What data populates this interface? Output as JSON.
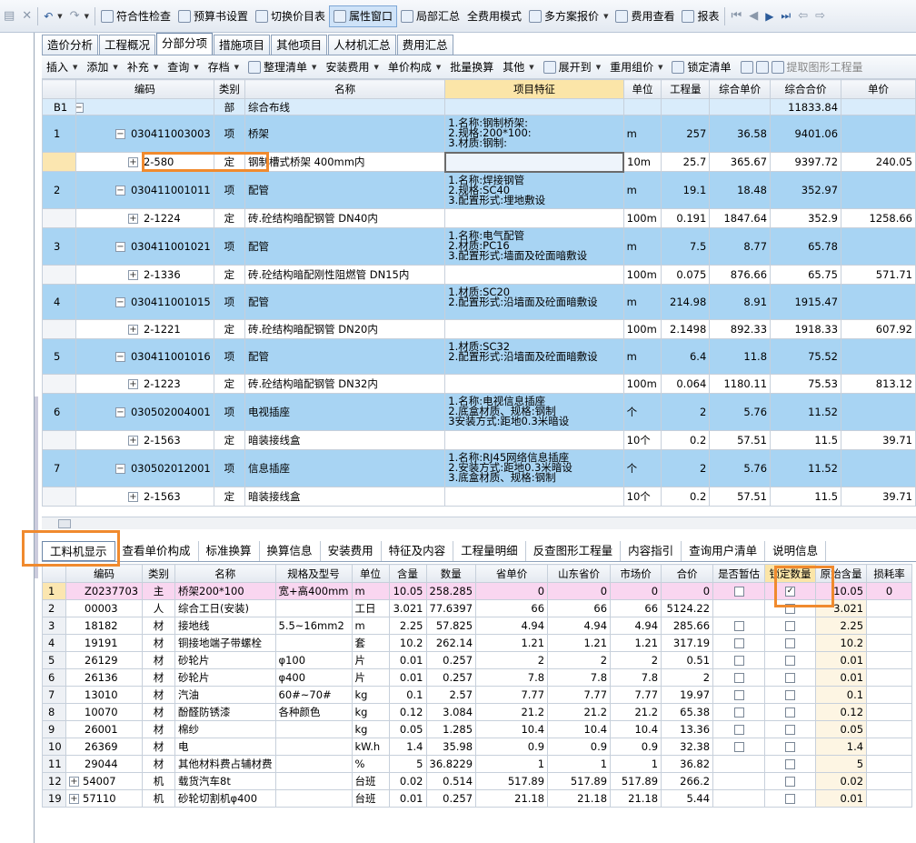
{
  "toolbar": {
    "items": [
      {
        "label": "符合性检查",
        "icon": "check-icon"
      },
      {
        "label": "预算书设置",
        "icon": "gear-icon"
      },
      {
        "label": "切换价目表",
        "icon": "switch-icon"
      },
      {
        "label": "属性窗口",
        "icon": "window-icon"
      },
      {
        "label": "局部汇总",
        "icon": "summary-icon"
      },
      {
        "label": "全费用模式",
        "icon": ""
      },
      {
        "label": "多方案报价",
        "icon": "scheme-icon"
      },
      {
        "label": "费用查看",
        "icon": "view-icon"
      },
      {
        "label": "报表",
        "icon": "report-icon"
      }
    ]
  },
  "tabs": [
    "造价分析",
    "工程概况",
    "分部分项",
    "措施项目",
    "其他项目",
    "人材机汇总",
    "费用汇总"
  ],
  "active_tab": "分部分项",
  "toolbar2": [
    "插入",
    "添加",
    "补充",
    "查询",
    "存档",
    "整理清单",
    "安装费用",
    "单价构成",
    "批量换算",
    "其他",
    "展开到",
    "重用组价",
    "锁定清单",
    "提取图形工程量"
  ],
  "grid1": {
    "headers": [
      "编码",
      "类别",
      "名称",
      "项目特征",
      "单位",
      "工程量",
      "综合单价",
      "综合合价",
      "单价"
    ],
    "rows": [
      {
        "rn": "B1",
        "type": "bu",
        "code": "",
        "cat": "部",
        "name": "综合布线",
        "feat": "",
        "unit": "",
        "qty": "",
        "uprice": "",
        "total": "11833.84",
        "price": ""
      },
      {
        "rn": "1",
        "type": "item",
        "code": "030411003003",
        "cat": "项",
        "name": "桥架",
        "feat": "1.名称:钢制桥架:\n2.规格:200*100:\n3.材质:钢制:",
        "unit": "m",
        "qty": "257",
        "uprice": "36.58",
        "total": "9401.06",
        "price": ""
      },
      {
        "rn": "",
        "type": "sel",
        "code": "2-580",
        "cat": "定",
        "name": "钢制槽式桥架 400mm内",
        "feat": "",
        "unit": "10m",
        "qty": "25.7",
        "uprice": "365.67",
        "total": "9397.72",
        "price": "240.05"
      },
      {
        "rn": "2",
        "type": "item",
        "code": "030411001011",
        "cat": "项",
        "name": "配管",
        "feat": "1.名称:焊接钢管\n2.规格:SC40\n3.配置形式:埋地敷设",
        "unit": "m",
        "qty": "19.1",
        "uprice": "18.48",
        "total": "352.97",
        "price": ""
      },
      {
        "rn": "",
        "type": "sub",
        "code": "2-1224",
        "cat": "定",
        "name": "砖.砼结构暗配钢管 DN40内",
        "feat": "",
        "unit": "100m",
        "qty": "0.191",
        "uprice": "1847.64",
        "total": "352.9",
        "price": "1258.66"
      },
      {
        "rn": "3",
        "type": "item",
        "code": "030411001021",
        "cat": "项",
        "name": "配管",
        "feat": "1.名称:电气配管\n2.材质:PC16\n3.配置形式:墙面及砼面暗敷设",
        "unit": "m",
        "qty": "7.5",
        "uprice": "8.77",
        "total": "65.78",
        "price": ""
      },
      {
        "rn": "",
        "type": "sub",
        "code": "2-1336",
        "cat": "定",
        "name": "砖.砼结构暗配刚性阻燃管 DN15内",
        "feat": "",
        "unit": "100m",
        "qty": "0.075",
        "uprice": "876.66",
        "total": "65.75",
        "price": "571.71"
      },
      {
        "rn": "4",
        "type": "item",
        "code": "030411001015",
        "cat": "项",
        "name": "配管",
        "feat": "1.材质:SC20\n2.配置形式:沿墙面及砼面暗敷设",
        "unit": "m",
        "qty": "214.98",
        "uprice": "8.91",
        "total": "1915.47",
        "price": ""
      },
      {
        "rn": "",
        "type": "sub",
        "code": "2-1221",
        "cat": "定",
        "name": "砖.砼结构暗配钢管 DN20内",
        "feat": "",
        "unit": "100m",
        "qty": "2.1498",
        "uprice": "892.33",
        "total": "1918.33",
        "price": "607.92"
      },
      {
        "rn": "5",
        "type": "item",
        "code": "030411001016",
        "cat": "项",
        "name": "配管",
        "feat": "1.材质:SC32\n2.配置形式:沿墙面及砼面暗敷设",
        "unit": "m",
        "qty": "6.4",
        "uprice": "11.8",
        "total": "75.52",
        "price": ""
      },
      {
        "rn": "",
        "type": "sub",
        "code": "2-1223",
        "cat": "定",
        "name": "砖.砼结构暗配钢管 DN32内",
        "feat": "",
        "unit": "100m",
        "qty": "0.064",
        "uprice": "1180.11",
        "total": "75.53",
        "price": "813.12"
      },
      {
        "rn": "6",
        "type": "item",
        "code": "030502004001",
        "cat": "项",
        "name": "电视插座",
        "feat": "1.名称:电视信息插座\n2.底盒材质、规格:钢制\n3安装方式:距地0.3米暗设",
        "unit": "个",
        "qty": "2",
        "uprice": "5.76",
        "total": "11.52",
        "price": ""
      },
      {
        "rn": "",
        "type": "sub",
        "code": "2-1563",
        "cat": "定",
        "name": "暗装接线盒",
        "feat": "",
        "unit": "10个",
        "qty": "0.2",
        "uprice": "57.51",
        "total": "11.5",
        "price": "39.71"
      },
      {
        "rn": "7",
        "type": "item",
        "code": "030502012001",
        "cat": "项",
        "name": "信息插座",
        "feat": "1.名称:RJ45网络信息插座\n2.安装方式:距地0.3米暗设\n3.底盒材质、规格:钢制",
        "unit": "个",
        "qty": "2",
        "uprice": "5.76",
        "total": "11.52",
        "price": ""
      },
      {
        "rn": "",
        "type": "sub",
        "code": "2-1563",
        "cat": "定",
        "name": "暗装接线盒",
        "feat": "",
        "unit": "10个",
        "qty": "0.2",
        "uprice": "57.51",
        "total": "11.5",
        "price": "39.71"
      }
    ]
  },
  "tabs2": [
    "工料机显示",
    "查看单价构成",
    "标准换算",
    "换算信息",
    "安装费用",
    "特征及内容",
    "工程量明细",
    "反查图形工程量",
    "内容指引",
    "查询用户清单",
    "说明信息"
  ],
  "active_tab2": "工料机显示",
  "grid2": {
    "headers": [
      "编码",
      "类别",
      "名称",
      "规格及型号",
      "单位",
      "含量",
      "数量",
      "省单价",
      "山东省价",
      "市场价",
      "合价",
      "是否暂估",
      "锁定数量",
      "原始含量",
      "损耗率"
    ],
    "rows": [
      {
        "rn": "1",
        "exp": false,
        "code": "Z0237703",
        "cat": "主",
        "name": "桥架200*100",
        "spec": "宽+高400mm",
        "unit": "m",
        "cont": "10.05",
        "qty": "258.285",
        "sp": "0",
        "sd": "0",
        "mk": "0",
        "tot": "0",
        "zg": false,
        "lock": true,
        "orig": "10.05",
        "loss": "0"
      },
      {
        "rn": "2",
        "exp": false,
        "code": "00003",
        "cat": "人",
        "name": "综合工日(安装)",
        "spec": "",
        "unit": "工日",
        "cont": "3.021",
        "qty": "77.6397",
        "sp": "66",
        "sd": "66",
        "mk": "66",
        "tot": "5124.22",
        "zg": null,
        "lock": false,
        "orig": "3.021",
        "loss": ""
      },
      {
        "rn": "3",
        "exp": false,
        "code": "18182",
        "cat": "材",
        "name": "接地线",
        "spec": "5.5~16mm2",
        "unit": "m",
        "cont": "2.25",
        "qty": "57.825",
        "sp": "4.94",
        "sd": "4.94",
        "mk": "4.94",
        "tot": "285.66",
        "zg": false,
        "lock": false,
        "orig": "2.25",
        "loss": ""
      },
      {
        "rn": "4",
        "exp": false,
        "code": "19191",
        "cat": "材",
        "name": "铜接地端子带螺栓",
        "spec": "",
        "unit": "套",
        "cont": "10.2",
        "qty": "262.14",
        "sp": "1.21",
        "sd": "1.21",
        "mk": "1.21",
        "tot": "317.19",
        "zg": false,
        "lock": false,
        "orig": "10.2",
        "loss": ""
      },
      {
        "rn": "5",
        "exp": false,
        "code": "26129",
        "cat": "材",
        "name": "砂轮片",
        "spec": "φ100",
        "unit": "片",
        "cont": "0.01",
        "qty": "0.257",
        "sp": "2",
        "sd": "2",
        "mk": "2",
        "tot": "0.51",
        "zg": false,
        "lock": false,
        "orig": "0.01",
        "loss": ""
      },
      {
        "rn": "6",
        "exp": false,
        "code": "26136",
        "cat": "材",
        "name": "砂轮片",
        "spec": "φ400",
        "unit": "片",
        "cont": "0.01",
        "qty": "0.257",
        "sp": "7.8",
        "sd": "7.8",
        "mk": "7.8",
        "tot": "2",
        "zg": false,
        "lock": false,
        "orig": "0.01",
        "loss": ""
      },
      {
        "rn": "7",
        "exp": false,
        "code": "13010",
        "cat": "材",
        "name": "汽油",
        "spec": "60#~70#",
        "unit": "kg",
        "cont": "0.1",
        "qty": "2.57",
        "sp": "7.77",
        "sd": "7.77",
        "mk": "7.77",
        "tot": "19.97",
        "zg": false,
        "lock": false,
        "orig": "0.1",
        "loss": ""
      },
      {
        "rn": "8",
        "exp": false,
        "code": "10070",
        "cat": "材",
        "name": "酚醛防锈漆",
        "spec": "各种颜色",
        "unit": "kg",
        "cont": "0.12",
        "qty": "3.084",
        "sp": "21.2",
        "sd": "21.2",
        "mk": "21.2",
        "tot": "65.38",
        "zg": false,
        "lock": false,
        "orig": "0.12",
        "loss": ""
      },
      {
        "rn": "9",
        "exp": false,
        "code": "26001",
        "cat": "材",
        "name": "棉纱",
        "spec": "",
        "unit": "kg",
        "cont": "0.05",
        "qty": "1.285",
        "sp": "10.4",
        "sd": "10.4",
        "mk": "10.4",
        "tot": "13.36",
        "zg": false,
        "lock": false,
        "orig": "0.05",
        "loss": ""
      },
      {
        "rn": "10",
        "exp": false,
        "code": "26369",
        "cat": "材",
        "name": "电",
        "spec": "",
        "unit": "kW.h",
        "cont": "1.4",
        "qty": "35.98",
        "sp": "0.9",
        "sd": "0.9",
        "mk": "0.9",
        "tot": "32.38",
        "zg": false,
        "lock": false,
        "orig": "1.4",
        "loss": ""
      },
      {
        "rn": "11",
        "exp": false,
        "code": "29044",
        "cat": "材",
        "name": "其他材料费占辅材费",
        "spec": "",
        "unit": "%",
        "cont": "5",
        "qty": "36.8229",
        "sp": "1",
        "sd": "1",
        "mk": "1",
        "tot": "36.82",
        "zg": null,
        "lock": false,
        "orig": "5",
        "loss": ""
      },
      {
        "rn": "12",
        "exp": true,
        "code": "54007",
        "cat": "机",
        "name": "载货汽车8t",
        "spec": "",
        "unit": "台班",
        "cont": "0.02",
        "qty": "0.514",
        "sp": "517.89",
        "sd": "517.89",
        "mk": "517.89",
        "tot": "266.2",
        "zg": null,
        "lock": false,
        "orig": "0.02",
        "loss": ""
      },
      {
        "rn": "19",
        "exp": true,
        "code": "57110",
        "cat": "机",
        "name": "砂轮切割机φ400",
        "spec": "",
        "unit": "台班",
        "cont": "0.01",
        "qty": "0.257",
        "sp": "21.18",
        "sd": "21.18",
        "mk": "21.18",
        "tot": "5.44",
        "zg": null,
        "lock": false,
        "orig": "0.01",
        "loss": ""
      }
    ]
  }
}
